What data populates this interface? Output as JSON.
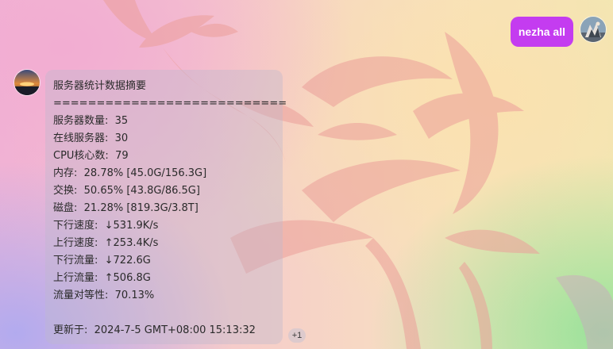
{
  "user_message": {
    "text": "nezha all"
  },
  "bot_message": {
    "lines": [
      "服务器统计数据摘要",
      "===========================",
      "服务器数量:  35",
      "在线服务器:  30",
      "CPU核心数:  79",
      "内存:  28.78% [45.0G/156.3G]",
      "交换:  50.65% [43.8G/86.5G]",
      "磁盘:  21.28% [819.3G/3.8T]",
      "下行速度:  ↓531.9K/s",
      "上行速度:  ↑253.4K/s",
      "下行流量:  ↓722.6G",
      "上行流量:  ↑506.8G",
      "流量对等性:  70.13%",
      "",
      "更新于:  2024-7-5 GMT+08:00 15:13:32"
    ]
  },
  "reaction": {
    "label": "+1"
  },
  "colors": {
    "user_bubble": "#c43cf0",
    "bot_bubble": "rgba(190,185,205,0.38)"
  },
  "icons": {
    "user_avatar": "user-avatar-image",
    "bot_avatar": "bot-avatar-image"
  }
}
